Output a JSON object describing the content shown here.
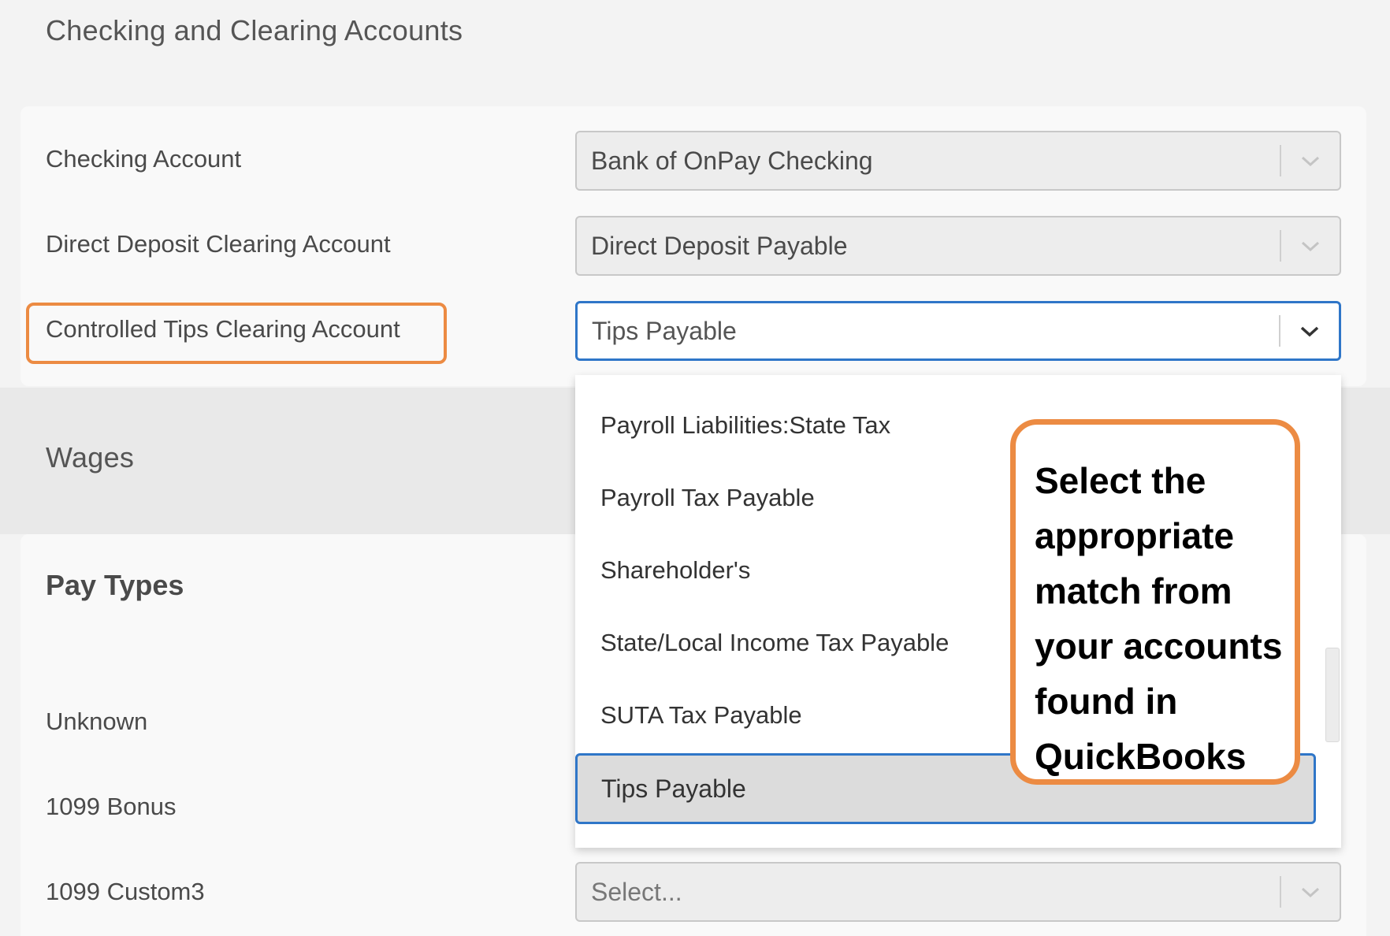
{
  "sections": {
    "checking_clearing_title": "Checking and Clearing Accounts",
    "wages_title": "Wages",
    "pay_types_title": "Pay Types"
  },
  "rows": {
    "checking_account": {
      "label": "Checking Account",
      "value": "Bank of OnPay Checking"
    },
    "direct_deposit": {
      "label": "Direct Deposit Clearing Account",
      "value": "Direct Deposit Payable"
    },
    "controlled_tips": {
      "label": "Controlled Tips Clearing Account",
      "value": "Tips Payable"
    },
    "unknown": {
      "label": "Unknown"
    },
    "bonus_1099": {
      "label": "1099 Bonus"
    },
    "custom3_1099": {
      "label": "1099 Custom3",
      "placeholder": "Select..."
    }
  },
  "dropdown": {
    "options": [
      "Payroll Liabilities:State Tax",
      "Payroll Tax Payable",
      "Shareholder's",
      "State/Local Income Tax Payable",
      "SUTA Tax Payable"
    ],
    "selected": "Tips Payable"
  },
  "callout": {
    "lines": [
      "Select the",
      "appropriate",
      "match from",
      "your accounts",
      "found in",
      "QuickBooks"
    ]
  },
  "icons": {
    "select_chevron": "chevron-down-icon"
  },
  "colors": {
    "highlight": "#ec8b43",
    "focus": "#2f76c8"
  }
}
